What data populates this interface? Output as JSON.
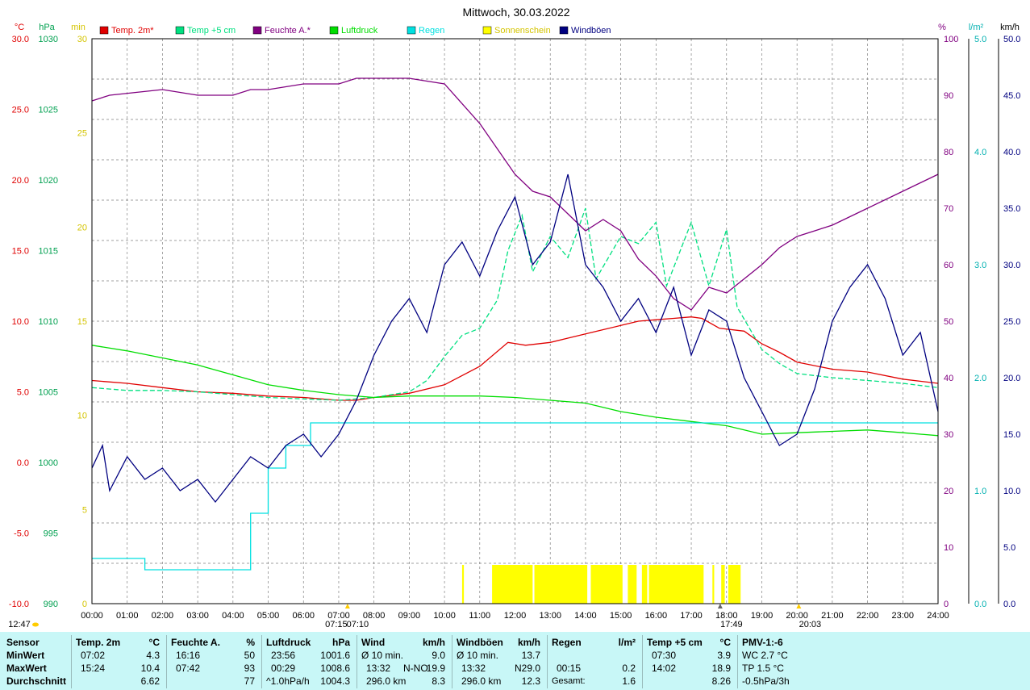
{
  "title": "Mittwoch, 30.03.2022",
  "units": {
    "temp": "°C",
    "press": "hPa",
    "sun": "min",
    "hum": "%",
    "rain": "l/m²",
    "wind": "km/h"
  },
  "colors": {
    "temp2m": "#e00000",
    "temp5cm": "#00e080",
    "humidity": "#800080",
    "pressure": "#00dd00",
    "rain": "#00e0e0",
    "sun": "#ffff00",
    "gusts": "#000080",
    "grid": "#808080",
    "stats_bg": "#c8f7f7"
  },
  "legend": [
    {
      "label": "Temp. 2m*",
      "color": "#e00000"
    },
    {
      "label": "Temp +5 cm",
      "color": "#00e080"
    },
    {
      "label": "Feuchte A.*",
      "color": "#800080"
    },
    {
      "label": "Luftdruck",
      "color": "#00dd00"
    },
    {
      "label": "Regen",
      "color": "#00e0e0"
    },
    {
      "label": "Sonnenschein",
      "color": "#ffff00"
    },
    {
      "label": "Windböen",
      "color": "#000080"
    }
  ],
  "chart_data": {
    "type": "line",
    "x_range_hours": [
      0,
      24
    ],
    "x_ticks": [
      "00:00",
      "01:00",
      "02:00",
      "03:00",
      "04:00",
      "05:00",
      "06:00",
      "07:00",
      "08:00",
      "09:00",
      "10:00",
      "11:00",
      "12:00",
      "13:00",
      "14:00",
      "15:00",
      "16:00",
      "17:00",
      "18:00",
      "19:00",
      "20:00",
      "21:00",
      "22:00",
      "23:00",
      "24:00"
    ],
    "axes": {
      "temp": {
        "range": [
          -10,
          30
        ],
        "ticks": [
          "30.0",
          "25.0",
          "20.0",
          "15.0",
          "10.0",
          "5.0",
          "0.0",
          "-5.0",
          "-10.0"
        ]
      },
      "pressure": {
        "range": [
          990,
          1030
        ],
        "ticks": [
          "1030",
          "1025",
          "1020",
          "1015",
          "1010",
          "1005",
          "1000",
          "995",
          "990"
        ]
      },
      "sun_min": {
        "range": [
          0,
          30
        ],
        "ticks": [
          "30",
          "25",
          "20",
          "15",
          "10",
          "5",
          "0"
        ]
      },
      "humidity": {
        "range": [
          0,
          100
        ],
        "ticks": [
          "100",
          "90",
          "80",
          "70",
          "60",
          "50",
          "40",
          "30",
          "20",
          "10",
          "0"
        ]
      },
      "rain": {
        "range": [
          0,
          5
        ],
        "ticks": [
          "5.0",
          "4.0",
          "3.0",
          "2.0",
          "1.0",
          "0.0"
        ]
      },
      "wind": {
        "range": [
          0,
          50
        ],
        "ticks": [
          "50.0",
          "45.0",
          "40.0",
          "35.0",
          "30.0",
          "25.0",
          "20.0",
          "15.0",
          "10.0",
          "5.0",
          "0.0"
        ]
      }
    },
    "series": [
      {
        "name": "Temp. 2m*",
        "axis": "temp",
        "points": [
          [
            0,
            5.8
          ],
          [
            1,
            5.6
          ],
          [
            2,
            5.3
          ],
          [
            3,
            5.0
          ],
          [
            4,
            4.9
          ],
          [
            5,
            4.7
          ],
          [
            6,
            4.6
          ],
          [
            7,
            4.4
          ],
          [
            7.5,
            4.4
          ],
          [
            8,
            4.6
          ],
          [
            9,
            4.9
          ],
          [
            10,
            5.5
          ],
          [
            11,
            6.8
          ],
          [
            11.8,
            8.5
          ],
          [
            12.3,
            8.3
          ],
          [
            13,
            8.5
          ],
          [
            13.5,
            8.8
          ],
          [
            14,
            9.1
          ],
          [
            14.5,
            9.4
          ],
          [
            15,
            9.7
          ],
          [
            15.5,
            10.0
          ],
          [
            16,
            10.1
          ],
          [
            16.5,
            10.2
          ],
          [
            17,
            10.3
          ],
          [
            17.3,
            10.2
          ],
          [
            17.8,
            9.5
          ],
          [
            18.5,
            9.3
          ],
          [
            19,
            8.4
          ],
          [
            19.5,
            7.8
          ],
          [
            20,
            7.1
          ],
          [
            21,
            6.6
          ],
          [
            22,
            6.4
          ],
          [
            23,
            5.9
          ],
          [
            24,
            5.6
          ]
        ]
      },
      {
        "name": "Temp +5 cm",
        "axis": "temp",
        "points": [
          [
            0,
            5.3
          ],
          [
            1,
            5.1
          ],
          [
            2,
            5.1
          ],
          [
            3,
            5.0
          ],
          [
            4,
            4.8
          ],
          [
            5,
            4.6
          ],
          [
            6,
            4.5
          ],
          [
            7,
            4.4
          ],
          [
            8,
            4.6
          ],
          [
            9,
            5.0
          ],
          [
            9.5,
            5.8
          ],
          [
            10,
            7.5
          ],
          [
            10.5,
            9.0
          ],
          [
            11,
            9.5
          ],
          [
            11.5,
            11.5
          ],
          [
            11.8,
            15.0
          ],
          [
            12.2,
            17.5
          ],
          [
            12.5,
            13.5
          ],
          [
            13,
            16.0
          ],
          [
            13.5,
            14.5
          ],
          [
            14,
            18.0
          ],
          [
            14.3,
            13.0
          ],
          [
            15,
            16.0
          ],
          [
            15.5,
            15.5
          ],
          [
            16,
            17.0
          ],
          [
            16.3,
            12.5
          ],
          [
            17,
            17.0
          ],
          [
            17.5,
            12.5
          ],
          [
            18,
            16.5
          ],
          [
            18.3,
            11.0
          ],
          [
            19,
            8.0
          ],
          [
            19.5,
            7.0
          ],
          [
            20,
            6.3
          ],
          [
            21,
            6.0
          ],
          [
            22,
            5.8
          ],
          [
            23,
            5.6
          ],
          [
            24,
            5.3
          ]
        ]
      },
      {
        "name": "Feuchte A.*",
        "axis": "humidity",
        "points": [
          [
            0,
            89
          ],
          [
            0.5,
            90
          ],
          [
            2,
            91
          ],
          [
            3,
            90
          ],
          [
            4,
            90
          ],
          [
            4.5,
            91
          ],
          [
            5,
            91
          ],
          [
            6,
            92
          ],
          [
            7,
            92
          ],
          [
            7.5,
            93
          ],
          [
            8,
            93
          ],
          [
            8.5,
            93
          ],
          [
            9,
            93
          ],
          [
            10,
            92
          ],
          [
            11,
            85
          ],
          [
            12,
            76
          ],
          [
            12.5,
            73
          ],
          [
            13,
            72
          ],
          [
            13.5,
            69
          ],
          [
            14,
            66
          ],
          [
            14.5,
            68
          ],
          [
            15,
            66
          ],
          [
            15.5,
            61
          ],
          [
            16,
            58
          ],
          [
            16.5,
            54
          ],
          [
            17,
            52
          ],
          [
            17.5,
            56
          ],
          [
            18,
            55
          ],
          [
            19,
            60
          ],
          [
            19.5,
            63
          ],
          [
            20,
            65
          ],
          [
            21,
            67
          ],
          [
            22,
            70
          ],
          [
            23,
            73
          ],
          [
            24,
            76
          ]
        ]
      },
      {
        "name": "Luftdruck",
        "axis": "pressure",
        "points": [
          [
            0,
            1008.3
          ],
          [
            1,
            1007.9
          ],
          [
            2,
            1007.4
          ],
          [
            3,
            1006.9
          ],
          [
            4,
            1006.2
          ],
          [
            5,
            1005.5
          ],
          [
            6,
            1005.1
          ],
          [
            7,
            1004.8
          ],
          [
            8,
            1004.6
          ],
          [
            9,
            1004.7
          ],
          [
            10,
            1004.7
          ],
          [
            11,
            1004.7
          ],
          [
            12,
            1004.6
          ],
          [
            13,
            1004.4
          ],
          [
            14,
            1004.2
          ],
          [
            15,
            1003.6
          ],
          [
            16,
            1003.2
          ],
          [
            17,
            1002.9
          ],
          [
            18,
            1002.6
          ],
          [
            19,
            1002.0
          ],
          [
            20,
            1002.1
          ],
          [
            21,
            1002.2
          ],
          [
            22,
            1002.3
          ],
          [
            23,
            1002.1
          ],
          [
            24,
            1001.9
          ]
        ]
      },
      {
        "name": "Regen",
        "axis": "rain",
        "points": [
          [
            0,
            0.4
          ],
          [
            0.5,
            0.4
          ],
          [
            1.5,
            0.4
          ],
          [
            1.5,
            0.3
          ],
          [
            3.5,
            0.3
          ],
          [
            4.5,
            0.3
          ],
          [
            4.5,
            0.8
          ],
          [
            5,
            0.8
          ],
          [
            5,
            1.2
          ],
          [
            5.5,
            1.2
          ],
          [
            5.5,
            1.4
          ],
          [
            6,
            1.4
          ],
          [
            6,
            1.4
          ],
          [
            6.2,
            1.4
          ],
          [
            6.2,
            1.6
          ],
          [
            6.5,
            1.6
          ],
          [
            6.5,
            1.6
          ],
          [
            7.0,
            1.6
          ],
          [
            7.0,
            1.6
          ],
          [
            10,
            1.6
          ],
          [
            24,
            1.6
          ]
        ]
      },
      {
        "name": "Windböen",
        "axis": "wind",
        "points": [
          [
            0,
            12
          ],
          [
            0.3,
            14
          ],
          [
            0.5,
            10
          ],
          [
            1,
            13
          ],
          [
            1.5,
            11
          ],
          [
            2,
            12
          ],
          [
            2.5,
            10
          ],
          [
            3,
            11
          ],
          [
            3.5,
            9
          ],
          [
            4,
            11
          ],
          [
            4.5,
            13
          ],
          [
            5,
            12
          ],
          [
            5.5,
            14
          ],
          [
            6,
            15
          ],
          [
            6.5,
            13
          ],
          [
            7,
            15
          ],
          [
            7.5,
            18
          ],
          [
            8,
            22
          ],
          [
            8.5,
            25
          ],
          [
            9,
            27
          ],
          [
            9.5,
            24
          ],
          [
            10,
            30
          ],
          [
            10.5,
            32
          ],
          [
            11,
            29
          ],
          [
            11.5,
            33
          ],
          [
            12,
            36
          ],
          [
            12.5,
            30
          ],
          [
            13,
            32
          ],
          [
            13.5,
            38
          ],
          [
            14,
            30
          ],
          [
            14.5,
            28
          ],
          [
            15,
            25
          ],
          [
            15.5,
            27
          ],
          [
            16,
            24
          ],
          [
            16.5,
            28
          ],
          [
            17,
            22
          ],
          [
            17.5,
            26
          ],
          [
            18,
            25
          ],
          [
            18.5,
            20
          ],
          [
            19,
            17
          ],
          [
            19.5,
            14
          ],
          [
            20,
            15
          ],
          [
            20.5,
            19
          ],
          [
            21,
            25
          ],
          [
            21.5,
            28
          ],
          [
            22,
            30
          ],
          [
            22.5,
            27
          ],
          [
            23,
            22
          ],
          [
            23.5,
            24
          ],
          [
            24,
            17
          ]
        ]
      }
    ],
    "sunshine_intervals_hours": [
      [
        10.5,
        10.55
      ],
      [
        11.35,
        12.5
      ],
      [
        12.55,
        14.05
      ],
      [
        14.15,
        15.05
      ],
      [
        15.2,
        15.45
      ],
      [
        15.6,
        15.75
      ],
      [
        15.8,
        17.35
      ],
      [
        17.6,
        17.65
      ],
      [
        17.85,
        17.95
      ],
      [
        18.05,
        18.4
      ]
    ],
    "markers": [
      {
        "time": "07:15",
        "hour": 7.25,
        "color": "#ffcc00"
      },
      {
        "time": "07:10",
        "hour": 7.17
      },
      {
        "time": "17:49",
        "hour": 17.82,
        "color": "#666666"
      },
      {
        "time": "20:03",
        "hour": 20.05,
        "color": "#ffcc00"
      }
    ]
  },
  "footer": {
    "now_time": "12:47"
  },
  "stats": {
    "row_labels": {
      "header": "Sensor",
      "min": "MinWert",
      "max": "MaxWert",
      "avg": "Durchschnitt"
    },
    "temp2m": {
      "header": "Temp. 2m",
      "unit": "°C",
      "min_time": "07:02",
      "min_val": "4.3",
      "max_time": "15:24",
      "max_val": "10.4",
      "avg": "6.62"
    },
    "humidity": {
      "header": "Feuchte A.",
      "unit": "%",
      "min_time": "16:16",
      "min_val": "50",
      "max_time": "07:42",
      "max_val": "93",
      "avg": "77"
    },
    "pressure": {
      "header": "Luftdruck",
      "unit": "hPa",
      "min_time": "23:56",
      "min_val": "1001.6",
      "max_time": "00:29",
      "max_val": "1008.6",
      "trend": "^1.0hPa/h",
      "avg": "1004.3"
    },
    "wind": {
      "header": "Wind",
      "unit": "km/h",
      "min_label": "Ø 10 min.",
      "min_val": "9.0",
      "max_time": "13:32",
      "max_dir": "N-NO",
      "max_val": "19.9",
      "run": "296.0 km",
      "avg": "8.3"
    },
    "gusts": {
      "header": "Windböen",
      "unit": "km/h",
      "min_label": "Ø 10 min.",
      "min_val": "13.7",
      "max_time": "13:32",
      "max_dir": "N",
      "max_val": "29.0",
      "run": "296.0 km",
      "avg": "12.3"
    },
    "rain": {
      "header": "Regen",
      "unit": "l/m²",
      "max_time": "00:15",
      "max_val": "0.2",
      "total_label": "Gesamt:",
      "total": "1.6"
    },
    "temp5": {
      "header": "Temp +5 cm",
      "unit": "°C",
      "min_time": "07:30",
      "min_val": "3.9",
      "max_time": "14:02",
      "max_val": "18.9",
      "avg": "8.26"
    },
    "pmv": {
      "header": "PMV-1:-6",
      "wc": "WC 2.7 °C",
      "tp": "TP 1.5 °C",
      "trend": "-0.5hPa/3h"
    }
  }
}
